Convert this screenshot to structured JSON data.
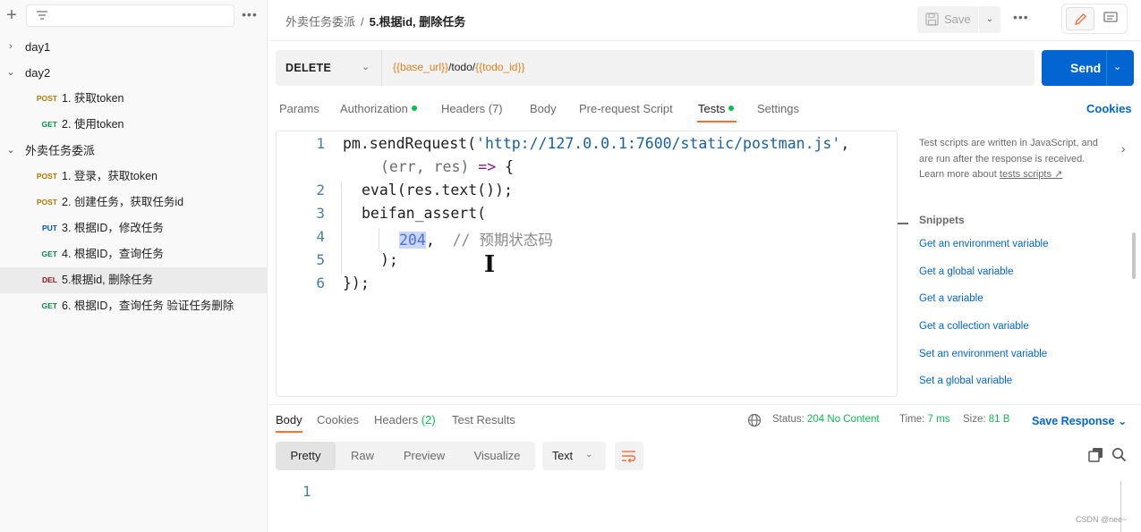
{
  "sidebar": {
    "new_icon": "plus-icon",
    "filter_icon": "filter-icon",
    "more_label": "•••",
    "tree": [
      {
        "type": "folder",
        "name": "day1",
        "expanded": false
      },
      {
        "type": "folder",
        "name": "day2",
        "expanded": true
      },
      {
        "type": "request",
        "method": "POST",
        "name": "1. 获取token"
      },
      {
        "type": "request",
        "method": "GET",
        "name": "2. 使用token"
      },
      {
        "type": "folder",
        "name": "外卖任务委派",
        "expanded": true
      },
      {
        "type": "request",
        "method": "POST",
        "name": "1. 登录，获取token"
      },
      {
        "type": "request",
        "method": "POST",
        "name": "2. 创建任务，获取任务id"
      },
      {
        "type": "request",
        "method": "PUT",
        "name": "3. 根据ID，修改任务"
      },
      {
        "type": "request",
        "method": "GET",
        "name": "4. 根据ID，查询任务"
      },
      {
        "type": "request",
        "method": "DEL",
        "name": "5.根据id, 删除任务",
        "active": true
      },
      {
        "type": "request",
        "method": "GET",
        "name": "6. 根据ID，查询任务 验证任务删除"
      }
    ]
  },
  "header": {
    "breadcrumb_parent": "外卖任务委派",
    "breadcrumb_sep": "/",
    "breadcrumb_current": "5.根据id, 删除任务",
    "save_label": "Save",
    "more_label": "•••"
  },
  "request": {
    "method": "DELETE",
    "url_parts": [
      {
        "text": "{{base_url}}",
        "kind": "var"
      },
      {
        "text": "/todo/",
        "kind": "text"
      },
      {
        "text": "{{todo_id}}",
        "kind": "var"
      }
    ],
    "send_label": "Send",
    "tabs": [
      {
        "label": "Params"
      },
      {
        "label": "Authorization",
        "dot": true
      },
      {
        "label": "Headers (7)"
      },
      {
        "label": "Body"
      },
      {
        "label": "Pre-request Script"
      },
      {
        "label": "Tests",
        "dot": true,
        "active": true
      },
      {
        "label": "Settings"
      }
    ],
    "cookies_label": "Cookies"
  },
  "editor": {
    "line_numbers": [
      "1",
      "2",
      "3",
      "4",
      "5",
      "6"
    ],
    "code": {
      "l1_a": "pm.sendRequest(",
      "l1_str": "'http://127.0.0.1:7600/static/postman.js'",
      "l1_b": ",",
      "l1_wrap_param": "(err, res)",
      "l1_wrap_arrow": " => ",
      "l1_wrap_brace": "{",
      "l2": "eval(res.text());",
      "l3": "beifan_assert(",
      "l4_sel": "204",
      "l4_rest": ",  ",
      "l4_cmt": "// 预期状态码",
      "l5": ");",
      "l6": "});"
    }
  },
  "helper": {
    "desc": "Test scripts are written in JavaScript, and are run after the response is received. Learn more about",
    "desc_link": "tests scripts ↗",
    "snippets_title": "Snippets",
    "snippets": [
      "Get an environment variable",
      "Get a global variable",
      "Get a variable",
      "Get a collection variable",
      "Set an environment variable",
      "Set a global variable"
    ]
  },
  "response": {
    "tabs": [
      {
        "label": "Body",
        "active": true
      },
      {
        "label": "Cookies"
      },
      {
        "label": "Headers",
        "count": "(2)"
      },
      {
        "label": "Test Results"
      }
    ],
    "status_label": "Status:",
    "status_value": "204 No Content",
    "time_label": "Time:",
    "time_value": "7 ms",
    "size_label": "Size:",
    "size_value": "81 B",
    "save_label": "Save Response",
    "view_modes": [
      "Pretty",
      "Raw",
      "Preview",
      "Visualize"
    ],
    "active_view": "Pretty",
    "format": "Text",
    "line_numbers": [
      "1"
    ]
  },
  "watermark": "CSDN @nee~",
  "colors": {
    "accent_orange": "#ff6c37",
    "send_blue": "#0265d2",
    "status_green": "#0cbb52",
    "var_orange": "#e0821d"
  }
}
